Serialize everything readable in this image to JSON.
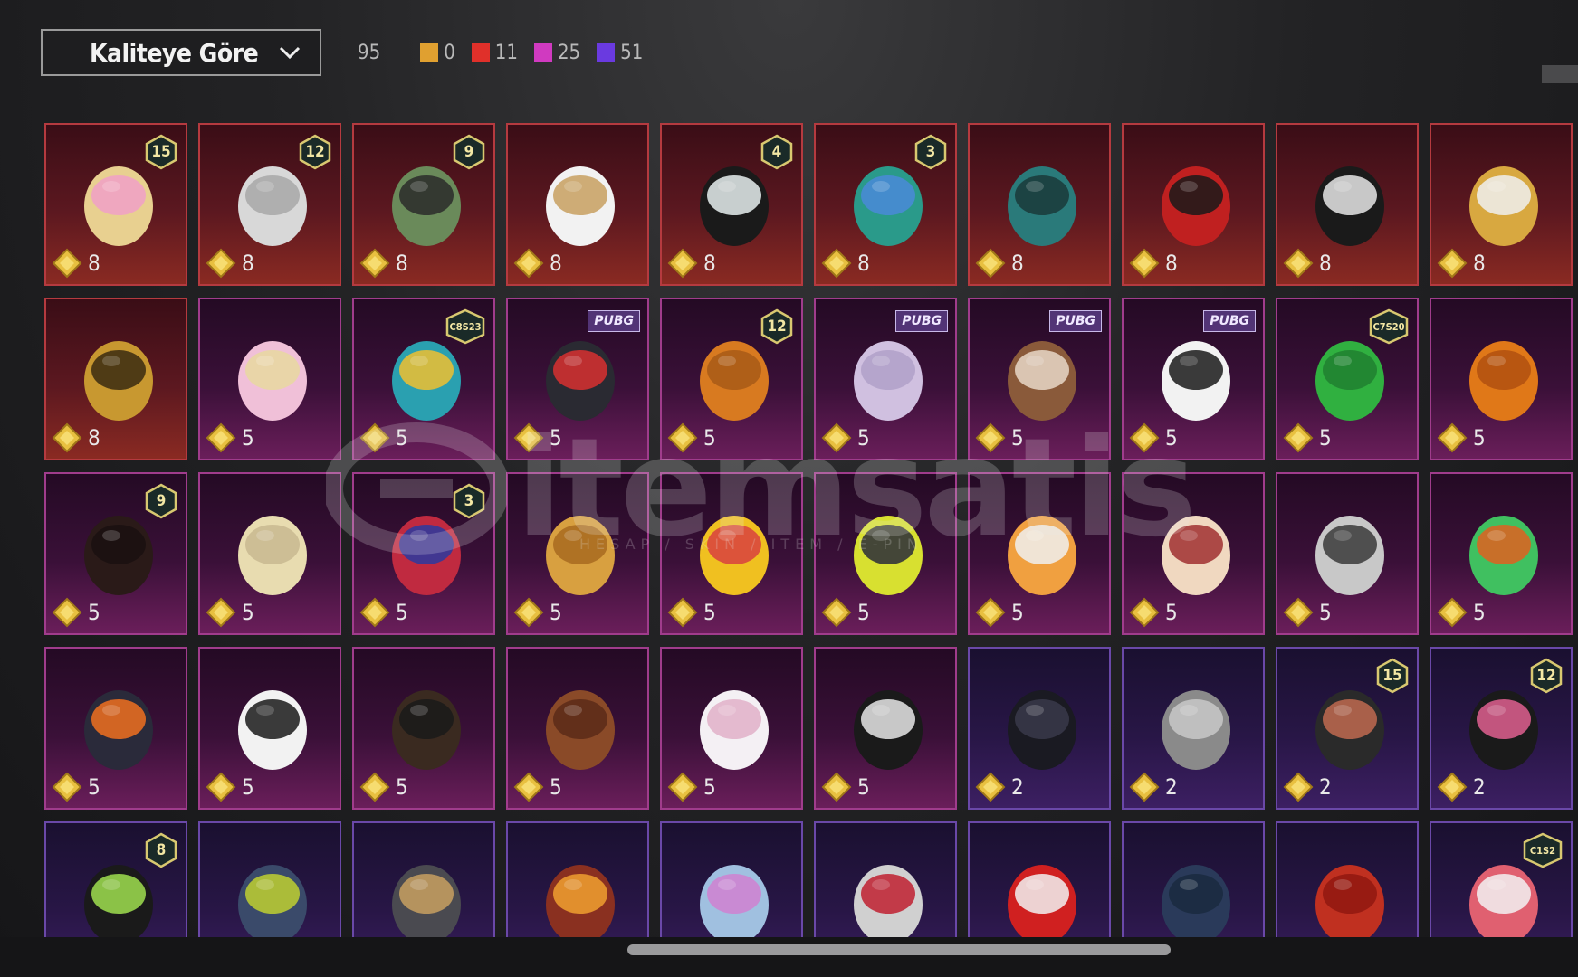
{
  "sort": {
    "label": "Kaliteye Göre"
  },
  "counts": {
    "total": "95",
    "gold": {
      "value": "0",
      "color": "#e0a030"
    },
    "red": {
      "value": "11",
      "color": "#e0302a"
    },
    "pink": {
      "value": "25",
      "color": "#d03ac0"
    },
    "purple": {
      "value": "51",
      "color": "#6a3ae0"
    }
  },
  "watermark": {
    "text": "itemsatis",
    "sub": "HESAP / SKIN / ITEM / E-PIN"
  },
  "rows": [
    [
      {
        "quality": "red",
        "price": "8",
        "badge": "15",
        "icon": "blonde-pink-hair-icon"
      },
      {
        "quality": "red",
        "price": "8",
        "badge": "12",
        "icon": "silver-hair-icon"
      },
      {
        "quality": "red",
        "price": "8",
        "badge": "9",
        "icon": "green-zombie-head-icon"
      },
      {
        "quality": "red",
        "price": "8",
        "badge": "",
        "icon": "white-cowboy-hat-icon"
      },
      {
        "quality": "red",
        "price": "8",
        "badge": "4",
        "icon": "top-hat-snowman-icon"
      },
      {
        "quality": "red",
        "price": "8",
        "badge": "3",
        "icon": "joker-head-icon"
      },
      {
        "quality": "red",
        "price": "8",
        "badge": "",
        "icon": "teal-spiked-helmet-icon"
      },
      {
        "quality": "red",
        "price": "8",
        "badge": "",
        "icon": "red-demon-mask-icon"
      },
      {
        "quality": "red",
        "price": "8",
        "badge": "",
        "icon": "white-mask-hood-icon"
      },
      {
        "quality": "red",
        "price": "8",
        "badge": "",
        "icon": "gold-winged-helmet-icon"
      }
    ],
    [
      {
        "quality": "red",
        "price": "8",
        "badge": "",
        "icon": "gold-pharaoh-helmet-icon"
      },
      {
        "quality": "pink",
        "price": "5",
        "badge": "",
        "icon": "pink-blonde-hair-icon"
      },
      {
        "quality": "pink",
        "price": "5",
        "badge": "C8S23",
        "icon": "cat-headphones-icon"
      },
      {
        "quality": "pink",
        "price": "5",
        "tag": "PUBG",
        "icon": "cap-red-goggles-icon"
      },
      {
        "quality": "pink",
        "price": "5",
        "badge": "12",
        "icon": "orange-pigtails-icon"
      },
      {
        "quality": "pink",
        "price": "5",
        "tag": "PUBG",
        "icon": "lilac-hair-icon"
      },
      {
        "quality": "pink",
        "price": "5",
        "tag": "PUBG",
        "icon": "llama-head-icon"
      },
      {
        "quality": "pink",
        "price": "5",
        "tag": "PUBG",
        "icon": "panda-head-icon"
      },
      {
        "quality": "pink",
        "price": "5",
        "badge": "C7S20",
        "icon": "green-pigtails-icon"
      },
      {
        "quality": "pink",
        "price": "5",
        "badge": "",
        "icon": "pumpkin-head-icon"
      }
    ],
    [
      {
        "quality": "pink",
        "price": "5",
        "badge": "9",
        "icon": "dark-long-hair-icon"
      },
      {
        "quality": "pink",
        "price": "5",
        "badge": "",
        "icon": "blonde-curls-icon"
      },
      {
        "quality": "pink",
        "price": "5",
        "badge": "3",
        "icon": "jester-hat-icon"
      },
      {
        "quality": "pink",
        "price": "5",
        "badge": "",
        "icon": "potato-head-icon"
      },
      {
        "quality": "pink",
        "price": "5",
        "badge": "",
        "icon": "duck-cap-icon"
      },
      {
        "quality": "pink",
        "price": "5",
        "badge": "",
        "icon": "yellow-moto-helmet-icon"
      },
      {
        "quality": "pink",
        "price": "5",
        "badge": "",
        "icon": "fox-helmet-icon"
      },
      {
        "quality": "pink",
        "price": "5",
        "badge": "",
        "icon": "cake-head-icon"
      },
      {
        "quality": "pink",
        "price": "5",
        "badge": "",
        "icon": "grey-dreadlocks-icon"
      },
      {
        "quality": "pink",
        "price": "5",
        "badge": "",
        "icon": "frog-hat-icon"
      }
    ],
    [
      {
        "quality": "pink",
        "price": "5",
        "badge": "",
        "icon": "orange-visor-helmet-icon"
      },
      {
        "quality": "pink",
        "price": "5",
        "badge": "",
        "icon": "white-beanie-icon"
      },
      {
        "quality": "pink",
        "price": "5",
        "badge": "",
        "icon": "horn-headband-icon"
      },
      {
        "quality": "pink",
        "price": "5",
        "badge": "",
        "icon": "bear-head-icon"
      },
      {
        "quality": "pink",
        "price": "5",
        "badge": "",
        "icon": "white-bucket-hat-icon"
      },
      {
        "quality": "pink",
        "price": "5",
        "badge": "",
        "icon": "skull-balaclava-icon"
      },
      {
        "quality": "purple",
        "price": "2",
        "badge": "",
        "icon": "black-bob-hair-icon"
      },
      {
        "quality": "purple",
        "price": "2",
        "badge": "",
        "icon": "grey-bob-hair-icon"
      },
      {
        "quality": "purple",
        "price": "2",
        "badge": "15",
        "icon": "pumpkin-beanie-hair-icon"
      },
      {
        "quality": "purple",
        "price": "2",
        "badge": "12",
        "icon": "bunny-helmet-icon"
      }
    ],
    [
      {
        "quality": "purple",
        "price": "",
        "badge": "8",
        "icon": "green-skull-hood-icon"
      },
      {
        "quality": "purple",
        "price": "",
        "badge": "",
        "icon": "gas-mask-helmet-icon"
      },
      {
        "quality": "purple",
        "price": "",
        "badge": "",
        "icon": "grey-helmet-icon"
      },
      {
        "quality": "purple",
        "price": "",
        "badge": "",
        "icon": "red-hair-goggles-icon"
      },
      {
        "quality": "purple",
        "price": "",
        "badge": "",
        "icon": "holo-cap-icon"
      },
      {
        "quality": "purple",
        "price": "",
        "badge": "",
        "icon": "horned-cap-icon"
      },
      {
        "quality": "purple",
        "price": "",
        "badge": "",
        "icon": "red-white-cap-icon"
      },
      {
        "quality": "purple",
        "price": "",
        "badge": "",
        "icon": "blue-beanie-icon"
      },
      {
        "quality": "purple",
        "price": "",
        "badge": "",
        "icon": "red-fez-icon"
      },
      {
        "quality": "purple",
        "price": "",
        "badge": "C1S2",
        "icon": "striped-beanie-icon"
      }
    ]
  ]
}
